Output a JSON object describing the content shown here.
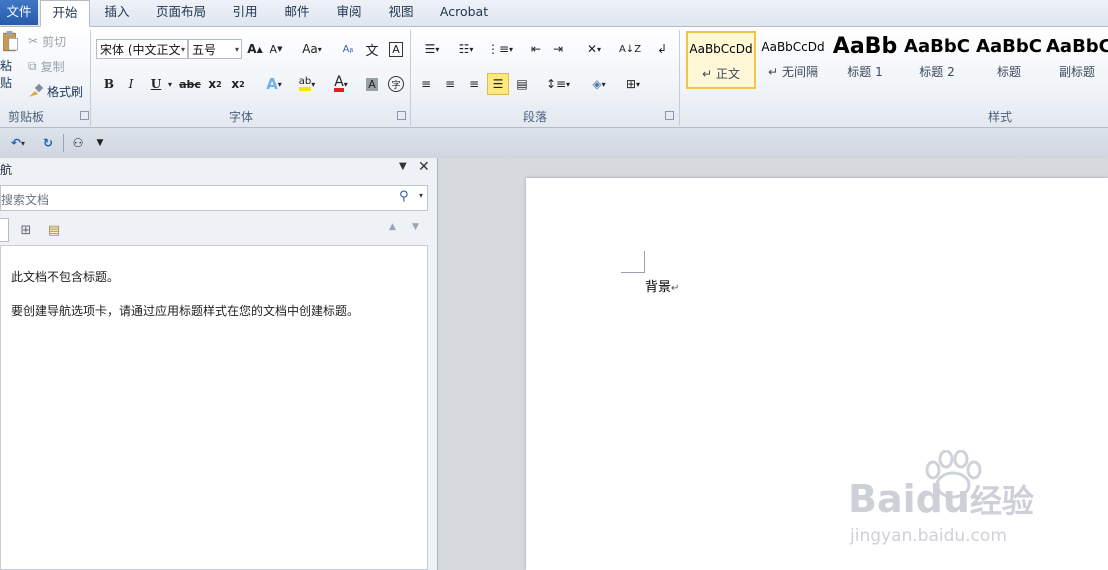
{
  "tabs": {
    "file": "文件",
    "home": "开始",
    "insert": "插入",
    "page_layout": "页面布局",
    "references": "引用",
    "mailings": "邮件",
    "review": "审阅",
    "view": "视图",
    "acrobat": "Acrobat"
  },
  "clipboard": {
    "paste": "粘贴",
    "cut": "剪切",
    "copy": "复制",
    "format_painter": "格式刷",
    "group_label": "剪贴板"
  },
  "font": {
    "font_name": "宋体 (中文正文",
    "font_size": "五号",
    "grow": "A",
    "shrink": "A",
    "change_case": "Aa",
    "bold": "B",
    "italic": "I",
    "underline": "U",
    "strike": "abc",
    "subscript": "x",
    "superscript": "x",
    "group_label": "字体"
  },
  "paragraph": {
    "group_label": "段落"
  },
  "styles": {
    "group_label": "样式",
    "items": [
      {
        "preview": "AaBbCcDd",
        "name": "正文",
        "mark": "↵"
      },
      {
        "preview": "AaBbCcDd",
        "name": "无间隔",
        "mark": "↵"
      },
      {
        "preview": "AaBb",
        "name": "标题 1"
      },
      {
        "preview": "AaBbC",
        "name": "标题 2"
      },
      {
        "preview": "AaBbC",
        "name": "标题"
      },
      {
        "preview": "AaBbC",
        "name": "副标题"
      }
    ]
  },
  "nav": {
    "title": "航",
    "search_placeholder": "搜索文档",
    "msg1": "此文档不包含标题。",
    "msg2": "要创建导航选项卡，请通过应用标题样式在您的文档中创建标题。"
  },
  "document": {
    "text": "背景",
    "para_mark": "↵"
  },
  "watermark": {
    "brand": "Bai",
    "brand2": "du",
    "brand_cn": "经验",
    "url": "jingyan.baidu.com"
  },
  "colors": {
    "accent": "#2b5faf",
    "highlight": "#fde980",
    "font_color": "#e02020"
  }
}
